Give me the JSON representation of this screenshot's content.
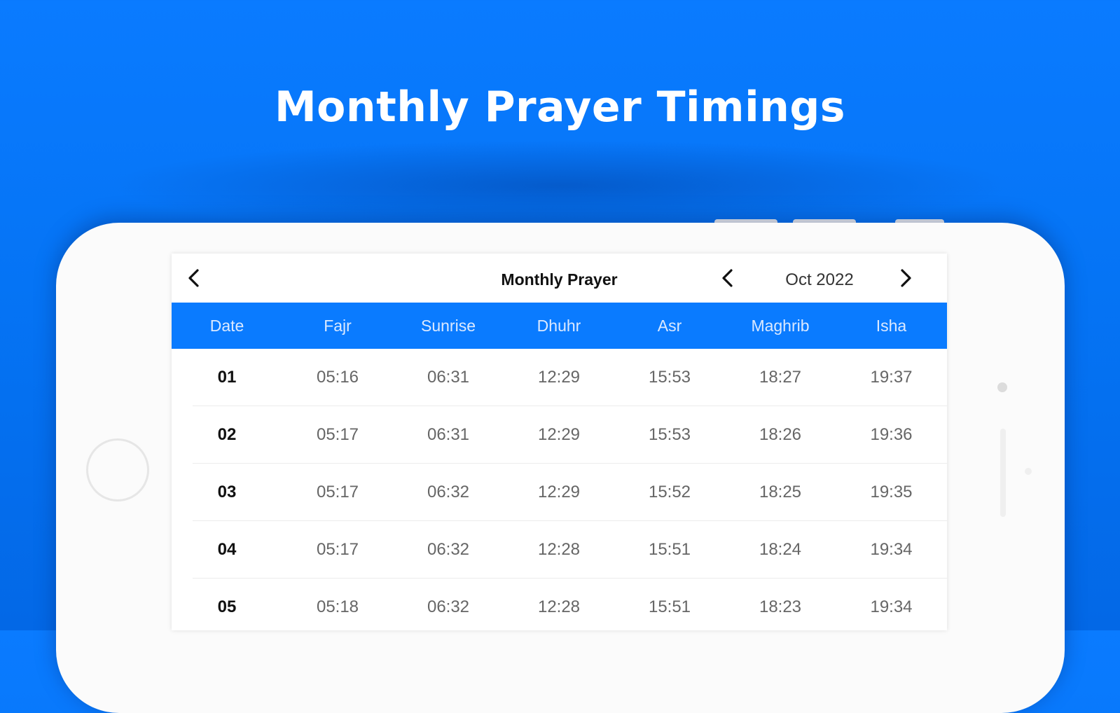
{
  "headline": "Monthly Prayer Timings",
  "appbar": {
    "title": "Monthly Prayer",
    "month": "Oct 2022",
    "back_icon": "chevron-left-icon",
    "prev_icon": "chevron-left-icon",
    "next_icon": "chevron-right-icon"
  },
  "colors": {
    "background": "#0a7bff",
    "header_row": "#0a7bff",
    "header_text": "#dbe9ff",
    "phone_body": "#fbfbfb"
  },
  "table": {
    "columns": [
      "Date",
      "Fajr",
      "Sunrise",
      "Dhuhr",
      "Asr",
      "Maghrib",
      "Isha"
    ],
    "rows": [
      [
        "01",
        "05:16",
        "06:31",
        "12:29",
        "15:53",
        "18:27",
        "19:37"
      ],
      [
        "02",
        "05:17",
        "06:31",
        "12:29",
        "15:53",
        "18:26",
        "19:36"
      ],
      [
        "03",
        "05:17",
        "06:32",
        "12:29",
        "15:52",
        "18:25",
        "19:35"
      ],
      [
        "04",
        "05:17",
        "06:32",
        "12:28",
        "15:51",
        "18:24",
        "19:34"
      ],
      [
        "05",
        "05:18",
        "06:32",
        "12:28",
        "15:51",
        "18:23",
        "19:34"
      ]
    ]
  }
}
